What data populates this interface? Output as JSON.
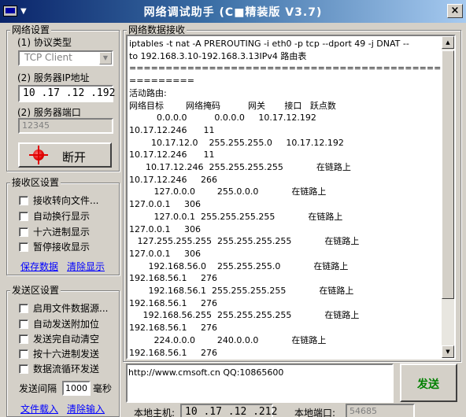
{
  "window": {
    "title": "网络调试助手  (C■精装版 V3.7)",
    "close": "×"
  },
  "network": {
    "group_title": "网络设置",
    "protocol_label": "(1) 协议类型",
    "protocol_value": "TCP Client",
    "server_ip_label": "(2) 服务器IP地址",
    "server_ip": "10 .17 .12 .192",
    "server_port_label": "(2) 服务器端口",
    "server_port_placeholder": "12345",
    "connect_button": "断开"
  },
  "receive": {
    "group_title": "接收区设置",
    "options": [
      "接收转向文件...",
      "自动换行显示",
      "十六进制显示",
      "暂停接收显示"
    ],
    "save_link": "保存数据",
    "clear_link": "清除显示",
    "panel_title": "网络数据接收",
    "lines": [
      "iptables -t nat -A PREROUTING -i eth0 -p tcp --dport 49 -j DNAT --",
      "to 192.168.3.10-192.168.3.13IPv4 路由表",
      "===================================================================",
      "=========",
      "活动路由:",
      "网络目标        网络掩码          网关       接口   跃点数",
      "          0.0.0.0          0.0.0.0     10.17.12.192",
      "10.17.12.246      11",
      "        10.17.12.0    255.255.255.0     10.17.12.192",
      "10.17.12.246      11",
      "      10.17.12.246  255.255.255.255            在链路上",
      "10.17.12.246     266",
      "         127.0.0.0        255.0.0.0            在链路上",
      "127.0.0.1     306",
      "         127.0.0.1  255.255.255.255            在链路上",
      "127.0.0.1     306",
      "   127.255.255.255  255.255.255.255            在链路上",
      "127.0.0.1     306",
      "       192.168.56.0    255.255.255.0            在链路上",
      "192.168.56.1     276",
      "       192.168.56.1  255.255.255.255            在链路上",
      "192.168.56.1     276",
      "     192.168.56.255  255.255.255.255            在链路上",
      "192.168.56.1     276",
      "         224.0.0.0        240.0.0.0            在链路上",
      "192.168.56.1     276"
    ]
  },
  "send": {
    "group_title": "发送区设置",
    "options": [
      "启用文件数据源...",
      "自动发送附加位",
      "发送完自动清空",
      "按十六进制发送",
      "数据流循环发送"
    ],
    "interval_label": "发送间隔",
    "interval_value": "1000",
    "interval_unit": "毫秒",
    "load_file_link": "文件载入",
    "clear_input_link": "清除输入",
    "content": "http://www.cmsoft.cn QQ:10865600",
    "send_button": "发送"
  },
  "status": {
    "local_host_label": "本地主机:",
    "local_host_ip": "10 .17 .12 .212",
    "local_port_label": "本地端口:",
    "local_port": "54685"
  },
  "colors": {
    "title_start": "#0a246a",
    "title_end": "#a6caf0",
    "send_green": "#008000",
    "link_blue": "#0000ff",
    "led_red": "#e00000"
  }
}
